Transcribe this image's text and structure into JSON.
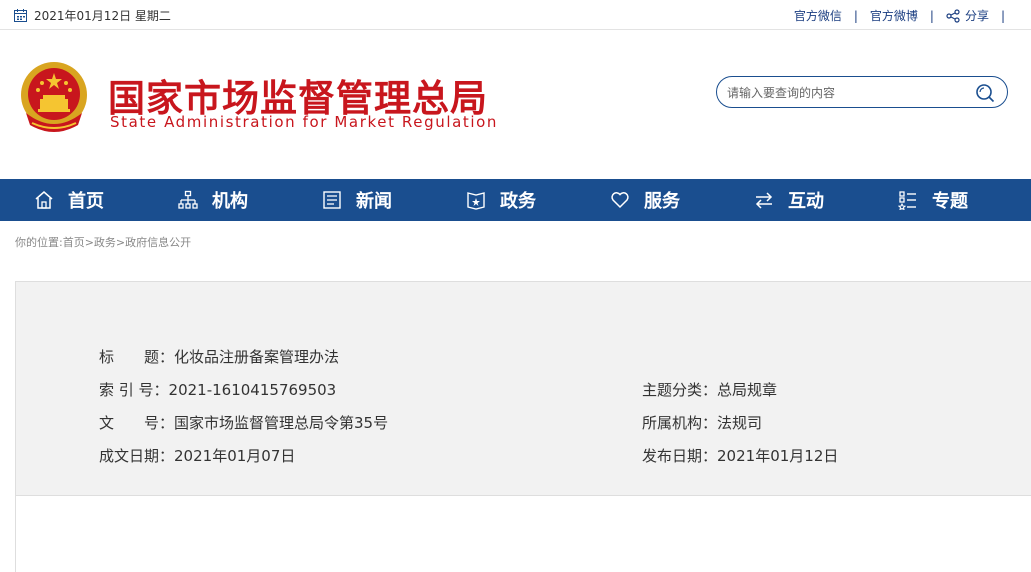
{
  "topbar": {
    "date": "2021年01月12日 星期二",
    "links": [
      "官方微信",
      "官方微博"
    ],
    "share": "分享",
    "separator": "|"
  },
  "header": {
    "title_cn": "国家市场监督管理总局",
    "title_en": "State Administration for Market Regulation",
    "search_placeholder": "请输入要查询的内容"
  },
  "nav": {
    "items": [
      {
        "label": "首页",
        "icon": "home-icon"
      },
      {
        "label": "机构",
        "icon": "org-chart-icon"
      },
      {
        "label": "新闻",
        "icon": "news-icon"
      },
      {
        "label": "政务",
        "icon": "government-icon"
      },
      {
        "label": "服务",
        "icon": "heart-icon"
      },
      {
        "label": "互动",
        "icon": "exchange-icon"
      },
      {
        "label": "专题",
        "icon": "topics-icon"
      }
    ]
  },
  "breadcrumb": "你的位置:首页>政务>政府信息公开",
  "info": {
    "title_key": "标　　题：",
    "title_val": "化妆品注册备案管理办法",
    "index_key": "索 引 号：",
    "index_val": "2021-1610415769503",
    "topic_key": "主题分类：",
    "topic_val": "总局规章",
    "docno_key": "文　　号：",
    "docno_val": "国家市场监督管理总局令第35号",
    "org_key": "所属机构：",
    "org_val": "法规司",
    "created_key": "成文日期：",
    "created_val": "2021年01月07日",
    "published_key": "发布日期：",
    "published_val": "2021年01月12日"
  },
  "colors": {
    "brand_red": "#c8161d",
    "nav_blue": "#1a4e8f",
    "info_bg": "#f2f2f2"
  }
}
